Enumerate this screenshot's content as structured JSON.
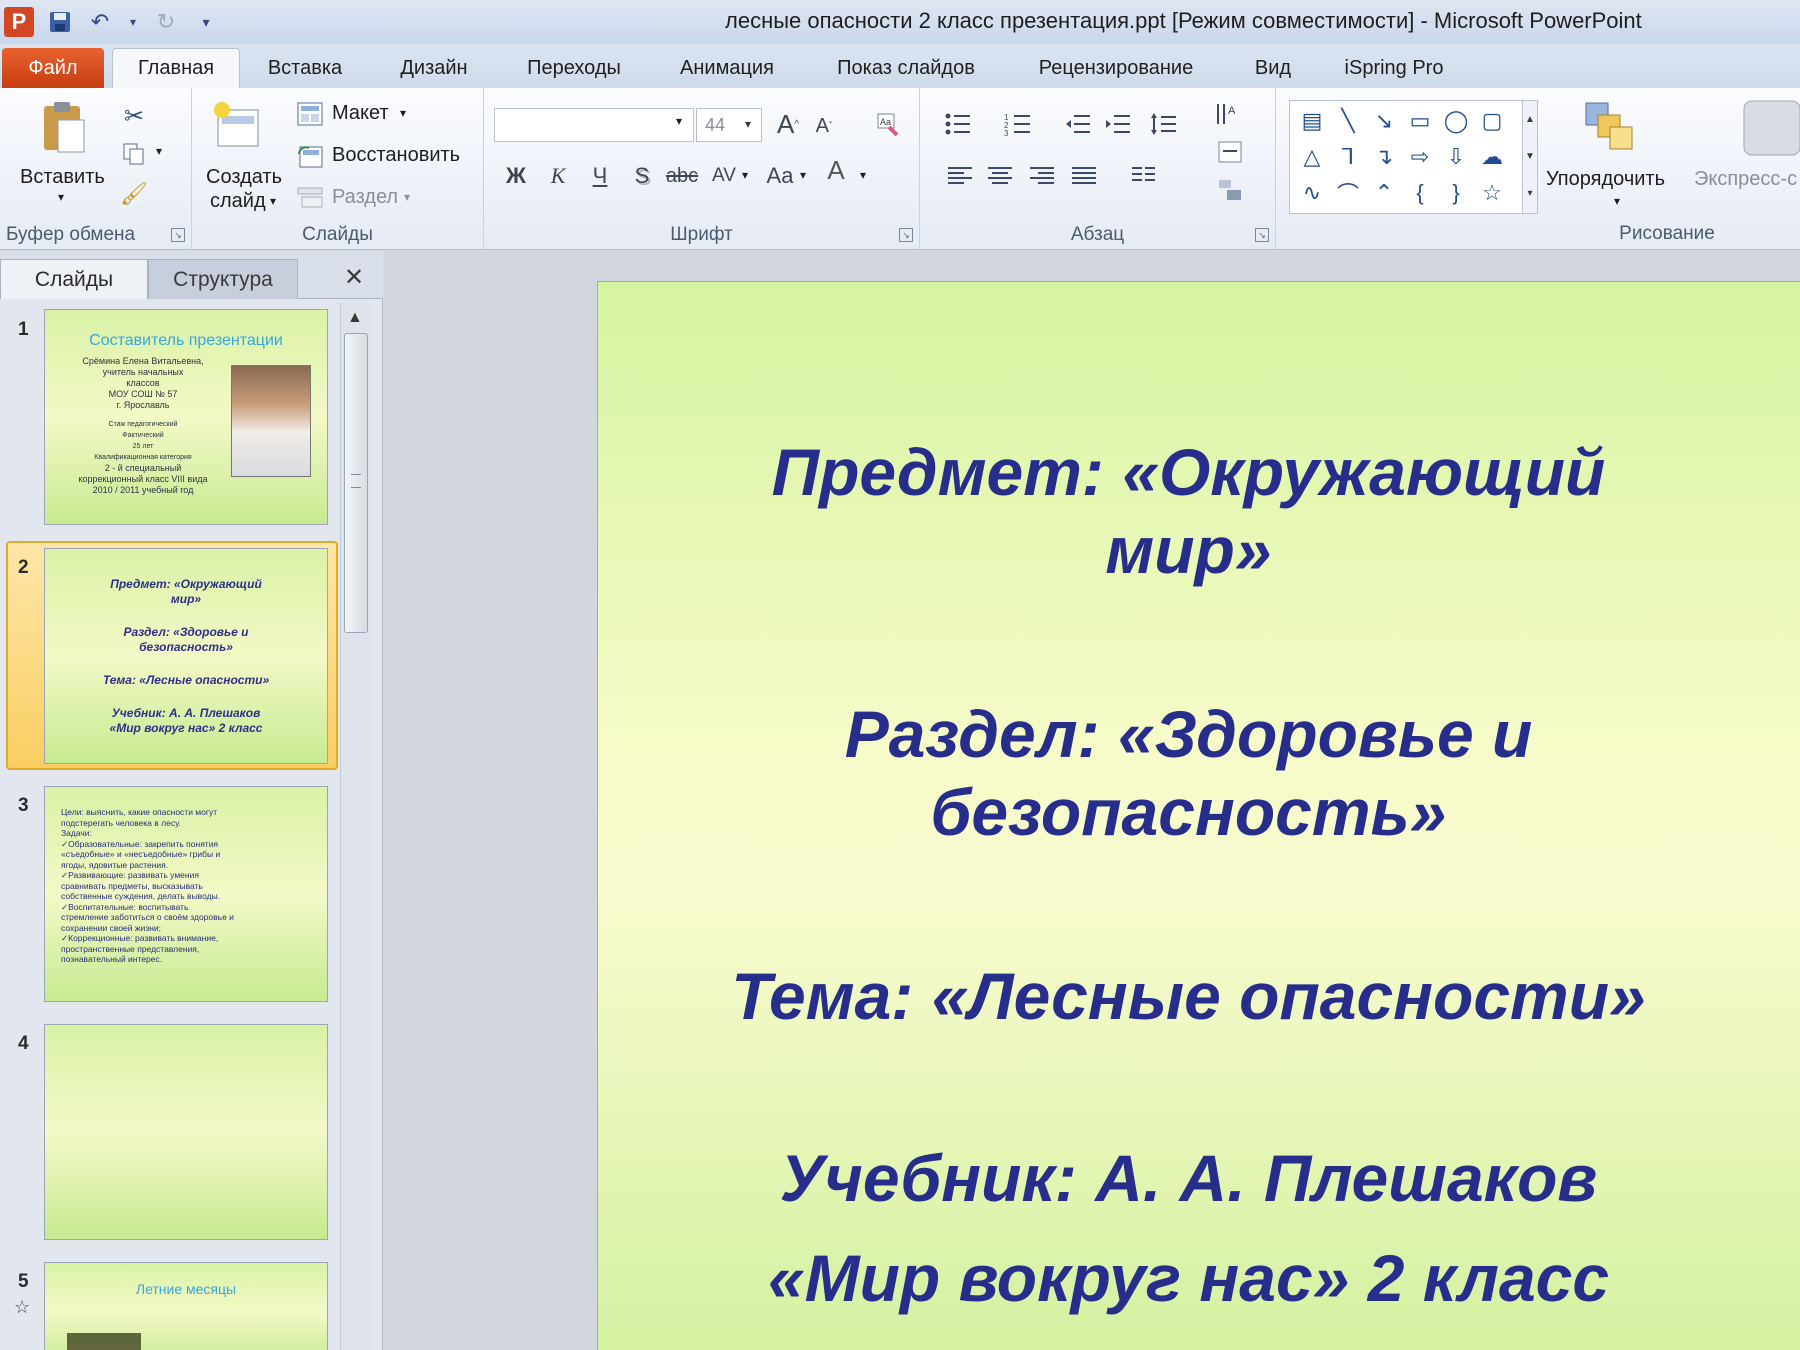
{
  "window": {
    "title": "лесные опасности 2 класс презентация.ppt [Режим совместимости]  -  Microsoft PowerPoint",
    "app_logo": "P"
  },
  "tabs": {
    "file": "Файл",
    "home": "Главная",
    "insert": "Вставка",
    "design": "Дизайн",
    "transitions": "Переходы",
    "animation": "Анимация",
    "slideshow": "Показ слайдов",
    "review": "Рецензирование",
    "view": "Вид",
    "ispring": "iSpring Pro"
  },
  "ribbon": {
    "clipboard": {
      "label": "Буфер обмена",
      "paste": "Вставить"
    },
    "slides": {
      "label": "Слайды",
      "new_slide_1": "Создать",
      "new_slide_2": "слайд",
      "layout": "Макет",
      "reset": "Восстановить",
      "section": "Раздел"
    },
    "font": {
      "label": "Шрифт",
      "size": "44",
      "bold": "Ж",
      "italic": "К",
      "underline": "Ч",
      "shadow": "S",
      "strike": "abc",
      "spacing": "AV",
      "case": "Aa",
      "color": "A",
      "grow": "A",
      "shrink": "A"
    },
    "paragraph": {
      "label": "Абзац"
    },
    "drawing": {
      "label": "Рисование",
      "arrange": "Упорядочить",
      "quick_styles": "Экспресс-с"
    }
  },
  "pane": {
    "tab_slides": "Слайды",
    "tab_outline": "Структура",
    "close": "✕"
  },
  "thumbnails": {
    "s1": {
      "num": "1",
      "title": "Составитель презентации",
      "lines": [
        "Срёмина Елена Витальевна,",
        "учитель начальных",
        "классов",
        "МОУ СОШ № 57",
        "г. Ярославль",
        "",
        "Стаж педагогический",
        "Фактический",
        "25 лет",
        "Квалификационная категория",
        "2 - й специальный",
        "коррекционный класс VIII вида",
        "2010 / 2011 учебный год"
      ]
    },
    "s2": {
      "num": "2",
      "lines": [
        "Предмет: «Окружающий",
        "мир»",
        "",
        "Раздел: «Здоровье и",
        "безопасность»",
        "",
        "Тема: «Лесные опасности»",
        "",
        "Учебник: А. А. Плешаков",
        "«Мир вокруг нас»    2 класс"
      ]
    },
    "s3": {
      "num": "3",
      "lines": [
        "Цели: выяснить, какие опасности могут",
        "подстерегать человека в лесу.",
        "Задачи:",
        "✓Образовательные: закрепить понятия",
        "«съедобные» и «несъедобные» грибы и",
        "ягоды, ядовитые растения.",
        "✓Развивающие: развивать умения",
        "сравнивать предметы, высказывать",
        "собственные суждения, делать выводы.",
        "✓Воспитательные: воспитывать",
        "стремление заботиться о своём здоровье и",
        "сохранении своей жизни;",
        "✓Коррекционные: развивать внимание,",
        "пространственные представления,",
        "познавательный интерес."
      ]
    },
    "s4": {
      "num": "4"
    },
    "s5": {
      "num": "5",
      "title": "Летние  месяцы"
    }
  },
  "slide": {
    "lines": [
      "Предмет: «Окружающий",
      "мир»",
      "Раздел: «Здоровье и",
      "безопасность»",
      "Тема: «Лесные опасности»",
      "Учебник: А. А. Плешаков",
      "«Мир вокруг нас»    2 класс"
    ]
  },
  "colors": {
    "slide_text": "#262d8b",
    "file_tab": "#d24726",
    "thumb_title": "#36a7dd"
  },
  "icons": [
    "save-icon",
    "undo-icon",
    "redo-icon",
    "paste-icon",
    "cut-icon",
    "copy-icon",
    "format-painter-icon",
    "new-slide-icon",
    "layout-icon",
    "reset-icon",
    "section-icon",
    "arrange-icon",
    "quick-styles-icon"
  ]
}
